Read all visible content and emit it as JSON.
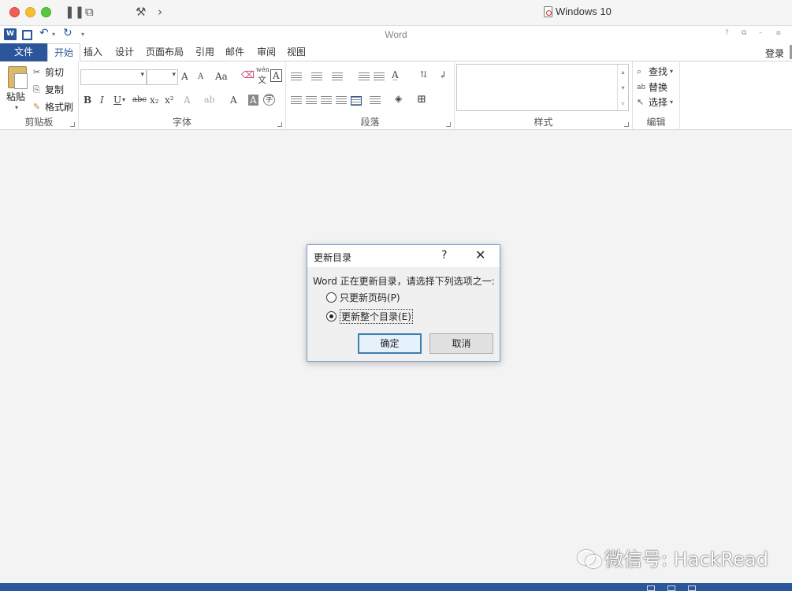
{
  "mac": {
    "window_title": "Windows 10"
  },
  "word": {
    "app_title": "Word",
    "qat_logo": "W",
    "qat_undo": "↶",
    "qat_redo": "↻",
    "window_controls": [
      "?",
      "⧉",
      "–",
      "⧈"
    ],
    "tabs": [
      "文件",
      "开始",
      "插入",
      "设计",
      "页面布局",
      "引用",
      "邮件",
      "审阅",
      "视图"
    ],
    "active_tab": "开始",
    "login": "登录"
  },
  "ribbon": {
    "clipboard": {
      "label": "剪贴板",
      "paste": "粘贴",
      "cut": "剪切",
      "copy": "复制",
      "format_painter": "格式刷"
    },
    "font": {
      "label": "字体",
      "font_name": "",
      "font_size": "",
      "grow": "A",
      "shrink": "A",
      "change_case": "Aa",
      "phonetic_top": "wén",
      "phonetic_bottom": "文",
      "char_border": "A",
      "bold": "B",
      "italic": "I",
      "underline": "U",
      "strikethrough": "abc",
      "subscript": "x₂",
      "superscript": "x²",
      "text_effects": "A",
      "highlight": "ab",
      "font_color": "A",
      "char_shading": "A",
      "enclose": "字"
    },
    "paragraph": {
      "label": "段落"
    },
    "styles": {
      "label": "样式"
    },
    "editing": {
      "label": "编辑",
      "find": "查找",
      "replace": "替换",
      "select": "选择"
    }
  },
  "dialog": {
    "title": "更新目录",
    "help": "?",
    "close": "✕",
    "message": "Word 正在更新目录，请选择下列选项之一:",
    "options": [
      {
        "label": "只更新页码(P)",
        "checked": false
      },
      {
        "label": "更新整个目录(E)",
        "checked": true
      }
    ],
    "ok": "确定",
    "cancel": "取消"
  },
  "watermark": {
    "text": "微信号: HackRead"
  }
}
